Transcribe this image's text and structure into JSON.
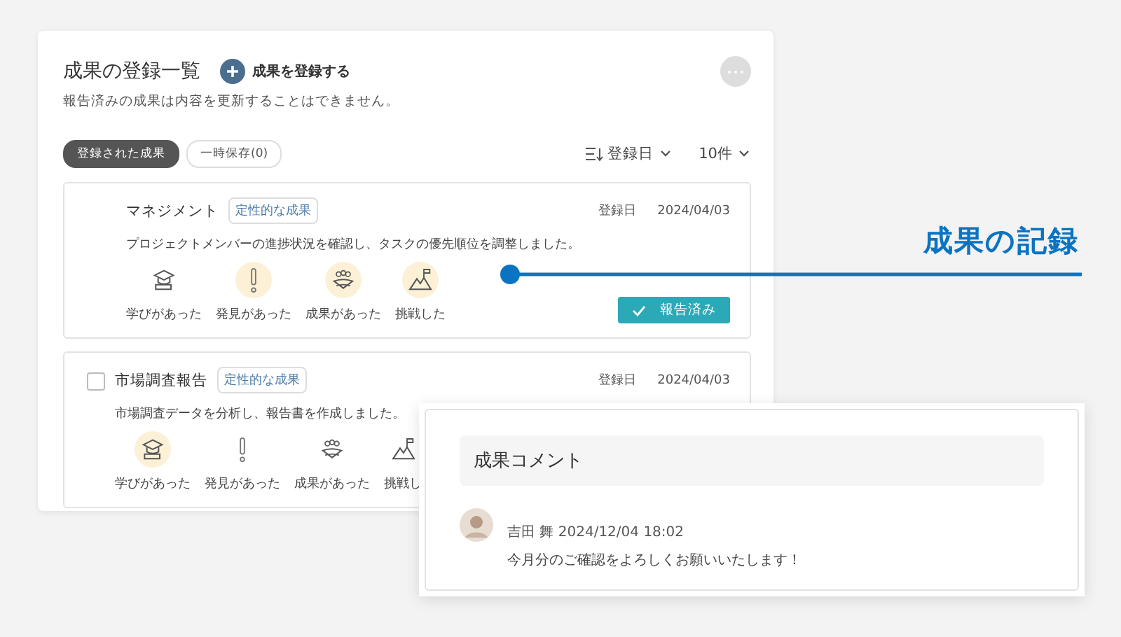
{
  "list_panel": {
    "title": "成果の登録一覧",
    "add_button": "成果を登録する",
    "notice": "報告済みの成果は内容を更新することはできません。",
    "filter_tabs": [
      {
        "label": "登録された成果",
        "selected": true
      },
      {
        "label": "一時保存(0)",
        "selected": false
      }
    ],
    "sort": {
      "label": "登録日"
    },
    "page_size": {
      "label": "10件"
    }
  },
  "cards": [
    {
      "title": "マネジメント",
      "tag": "定性的な成果",
      "date_label": "登録日",
      "date": "2024/04/03",
      "description": "プロジェクトメンバーの進捗状況を確認し、タスクの優先順位を調整しました。",
      "reactions": [
        {
          "kind": "learning",
          "label": "学びがあった",
          "selected": false
        },
        {
          "kind": "discovery",
          "label": "発見があった",
          "selected": true
        },
        {
          "kind": "achievement",
          "label": "成果があった",
          "selected": true
        },
        {
          "kind": "challenge",
          "label": "挑戦した",
          "selected": true
        }
      ],
      "status": "報告済み"
    },
    {
      "title": "市場調査報告",
      "tag": "定性的な成果",
      "date_label": "登録日",
      "date": "2024/04/03",
      "description": "市場調査データを分析し、報告書を作成しました。",
      "reactions": [
        {
          "kind": "learning",
          "label": "学びがあった",
          "selected": true
        },
        {
          "kind": "discovery",
          "label": "発見があった",
          "selected": false
        },
        {
          "kind": "achievement",
          "label": "成果があった",
          "selected": false
        },
        {
          "kind": "challenge",
          "label": "挑戦し",
          "selected": false
        }
      ],
      "checkbox": {
        "checked": false
      }
    }
  ],
  "comment_popup": {
    "heading": "成果コメント",
    "author": "吉田 舞",
    "timestamp": "2024/12/04 18:02",
    "text": "今月分のご確認をよろしくお願いいたします！"
  },
  "callout": {
    "label": "成果の記録"
  }
}
